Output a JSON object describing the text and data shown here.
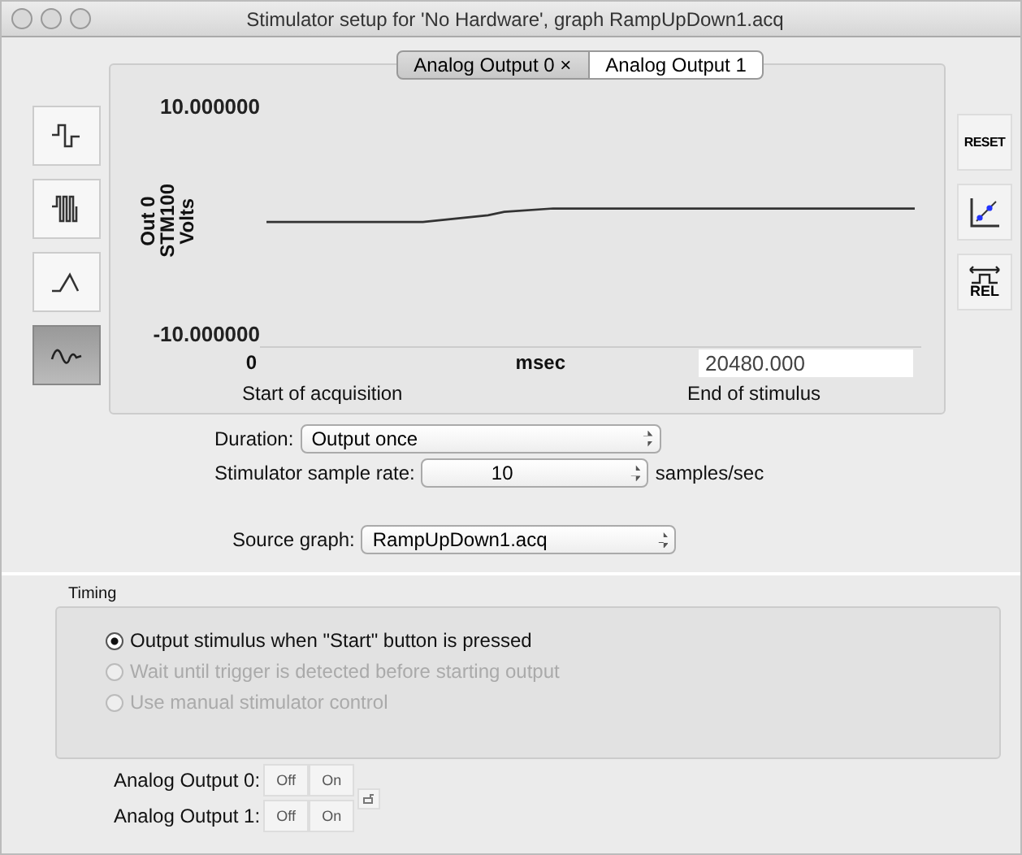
{
  "window": {
    "title": "Stimulator setup for 'No Hardware', graph RampUpDown1.acq"
  },
  "tabs": [
    {
      "label": "Analog Output 0 ×",
      "selected": true
    },
    {
      "label": "Analog Output 1",
      "selected": false
    }
  ],
  "wave_tools": [
    {
      "kind": "pulse",
      "selected": false
    },
    {
      "kind": "train",
      "selected": false
    },
    {
      "kind": "ramp",
      "selected": false
    },
    {
      "kind": "arbitrary",
      "selected": true
    }
  ],
  "side_tools": [
    {
      "kind": "reset",
      "label": "RESET"
    },
    {
      "kind": "scale"
    },
    {
      "kind": "rel",
      "label": "REL"
    }
  ],
  "graph": {
    "y_max": "10.000000",
    "y_min": "-10.000000",
    "y_label": [
      "Out 0",
      "STM100",
      "Volts"
    ],
    "x_start": "0",
    "x_unit": "msec",
    "x_end": "20480.000",
    "start_caption": "Start of acquisition",
    "end_caption": "End of stimulus"
  },
  "duration": {
    "label": "Duration:",
    "value": "Output once"
  },
  "sample_rate": {
    "label": "Stimulator sample rate:",
    "value": "10",
    "unit": "samples/sec"
  },
  "source_graph": {
    "label": "Source graph:",
    "value": "RampUpDown1.acq"
  },
  "timing": {
    "title": "Timing",
    "options": [
      {
        "label": "Output stimulus when \"Start\" button is pressed",
        "selected": true,
        "disabled": false
      },
      {
        "label": "Wait until trigger is detected before starting output",
        "selected": false,
        "disabled": true
      },
      {
        "label": "Use manual stimulator control",
        "selected": false,
        "disabled": true
      }
    ]
  },
  "outputs": [
    {
      "label": "Analog Output 0:",
      "buttons": [
        "Off",
        "On"
      ]
    },
    {
      "label": "Analog Output 1:",
      "buttons": [
        "Off",
        "On"
      ]
    }
  ]
}
